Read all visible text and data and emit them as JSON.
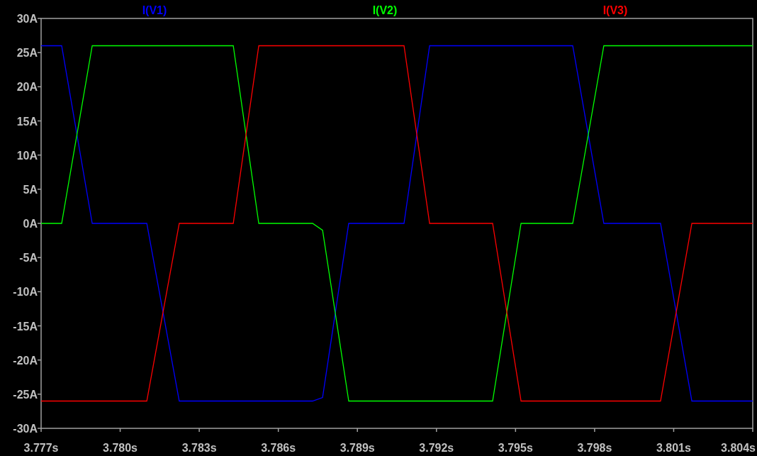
{
  "plot": {
    "chart_data": {
      "type": "line",
      "x": [
        3.777,
        3.77778,
        3.77894,
        3.78101,
        3.78224,
        3.78429,
        3.78526,
        3.7873,
        3.78768,
        3.78867,
        3.79077,
        3.79174,
        3.79413,
        3.79521,
        3.79717,
        3.79835,
        3.8005,
        3.80169,
        3.804
      ],
      "series": [
        {
          "name": "I(V1)",
          "color": "#0000ff",
          "values": [
            26,
            26,
            0,
            0,
            -26,
            -26,
            -26,
            -26,
            -25.5,
            0,
            0,
            26,
            26,
            26,
            26,
            0,
            0,
            -26,
            -26
          ]
        },
        {
          "name": "I(V2)",
          "color": "#00ff00",
          "values": [
            0,
            0,
            26,
            26,
            26,
            26,
            0,
            0,
            -1,
            -26,
            -26,
            -26,
            -26,
            0,
            0,
            26,
            26,
            26,
            26
          ]
        },
        {
          "name": "I(V3)",
          "color": "#ff0000",
          "values": [
            -26,
            -26,
            -26,
            -26,
            0,
            0,
            26,
            26,
            26,
            26,
            26,
            0,
            0,
            -26,
            -26,
            -26,
            -26,
            0,
            0
          ]
        }
      ],
      "xlim": [
        3.777,
        3.804
      ],
      "ylim": [
        -30,
        30
      ],
      "xticks": [
        {
          "value": 3.777,
          "label": "3.777s"
        },
        {
          "value": 3.78,
          "label": "3.780s"
        },
        {
          "value": 3.783,
          "label": "3.783s"
        },
        {
          "value": 3.786,
          "label": "3.786s"
        },
        {
          "value": 3.789,
          "label": "3.789s"
        },
        {
          "value": 3.792,
          "label": "3.792s"
        },
        {
          "value": 3.795,
          "label": "3.795s"
        },
        {
          "value": 3.798,
          "label": "3.798s"
        },
        {
          "value": 3.801,
          "label": "3.801s"
        },
        {
          "value": 3.804,
          "label": "3.804s"
        }
      ],
      "yticks": [
        {
          "value": 30,
          "label": "30A"
        },
        {
          "value": 25,
          "label": "25A"
        },
        {
          "value": 20,
          "label": "20A"
        },
        {
          "value": 15,
          "label": "15A"
        },
        {
          "value": 10,
          "label": "10A"
        },
        {
          "value": 5,
          "label": "5A"
        },
        {
          "value": 0,
          "label": "0A"
        },
        {
          "value": -5,
          "label": "-5A"
        },
        {
          "value": -10,
          "label": "-10A"
        },
        {
          "value": -15,
          "label": "-15A"
        },
        {
          "value": -20,
          "label": "-20A"
        },
        {
          "value": -25,
          "label": "-25A"
        },
        {
          "value": -30,
          "label": "-30A"
        }
      ]
    }
  }
}
